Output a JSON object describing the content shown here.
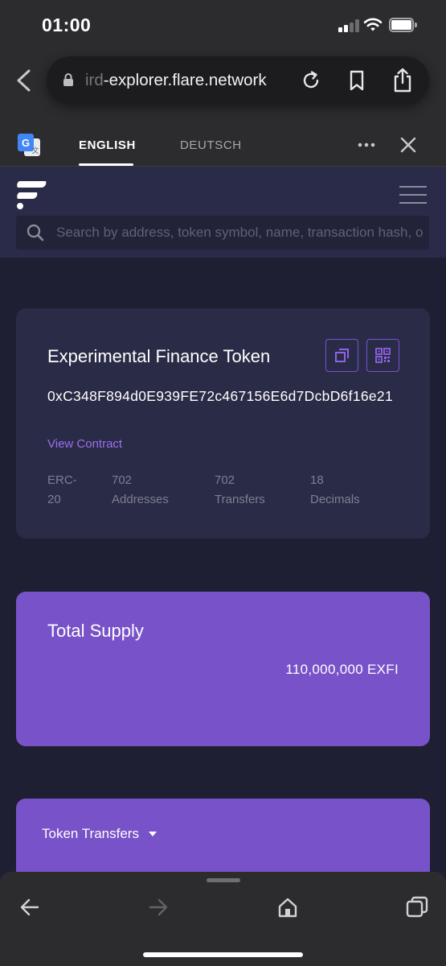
{
  "status_bar": {
    "time": "01:00",
    "icons": [
      "cellular-signal-icon",
      "wifi-icon",
      "battery-icon"
    ]
  },
  "browser": {
    "url_faded_prefix": "ird",
    "url": "-explorer.flare.network",
    "icons": [
      "back-icon",
      "lock-icon",
      "reload-icon",
      "bookmark-icon",
      "share-icon"
    ]
  },
  "translate_bar": {
    "tabs": [
      {
        "label": "ENGLISH",
        "active": true
      },
      {
        "label": "DEUTSCH",
        "active": false
      }
    ],
    "icons": [
      "google-translate-icon",
      "more-icon",
      "close-icon"
    ]
  },
  "site": {
    "search_placeholder": "Search by address, token symbol, name, transaction hash, or block number",
    "icons": [
      "flare-logo-icon",
      "hamburger-menu-icon",
      "search-icon"
    ]
  },
  "token": {
    "name": "Experimental Finance Token",
    "address": "0xC348F894d0E939FE72c467156E6d7DcbD6f16e21",
    "view_contract": "View Contract",
    "stats": [
      {
        "value": "ERC-",
        "label": "20"
      },
      {
        "value": "702",
        "label": "Addresses"
      },
      {
        "value": "702",
        "label": "Transfers"
      },
      {
        "value": "18",
        "label": "Decimals"
      }
    ],
    "icons": [
      "copy-icon",
      "qr-code-icon"
    ]
  },
  "supply": {
    "title": "Total Supply",
    "value": "110,000,000 EXFI"
  },
  "transfers": {
    "label": "Token Transfers"
  },
  "toolbar": {
    "icons": [
      "back-arrow-icon",
      "forward-arrow-icon",
      "home-icon",
      "tabs-icon"
    ]
  },
  "colors": {
    "page_bg": "#1f1f33",
    "header_bg": "#2a2b48",
    "card_bg": "#2a2b46",
    "accent_purple": "#7852c8",
    "link_purple": "#9a6ff0",
    "muted_text": "#7e7f93"
  }
}
